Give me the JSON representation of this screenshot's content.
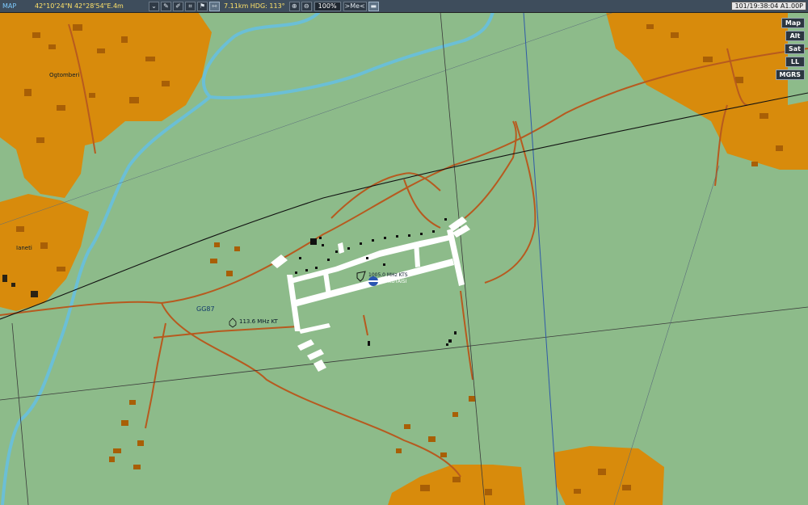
{
  "toolbar": {
    "title": "MAP",
    "coordinates": "42°10'24\"N 42°28'54\"E.4m",
    "distance_heading": "7.11km HDG: 113°",
    "zoom": "100%",
    "center_me": ">Me<",
    "time": "101/19:38:04 A1.00P",
    "icons": [
      "chevron-down-icon",
      "wrench-icon",
      "pen-icon",
      "ruler-icon",
      "flag-icon",
      "measure-icon",
      "zoom-in-icon",
      "zoom-out-icon",
      "minus-icon"
    ]
  },
  "layers": {
    "map": "Map",
    "alt": "Alt",
    "sat": "Sat",
    "ll": "LL",
    "mgrs": "MGRS"
  },
  "labels": {
    "town_1": "Ogtomberi",
    "town_2": "Ianeti",
    "grid_square": "GG87",
    "vor": "113.6 MHz KT",
    "airfield_freq": "1005.0 MHz KTS",
    "airfield_name": "50 KUTAISI"
  },
  "colors": {
    "terrain": "#8dbb8a",
    "urban": "#d88b0c",
    "river": "#6bbfd6",
    "road": "#b75a1f",
    "runway": "#ffffff"
  }
}
